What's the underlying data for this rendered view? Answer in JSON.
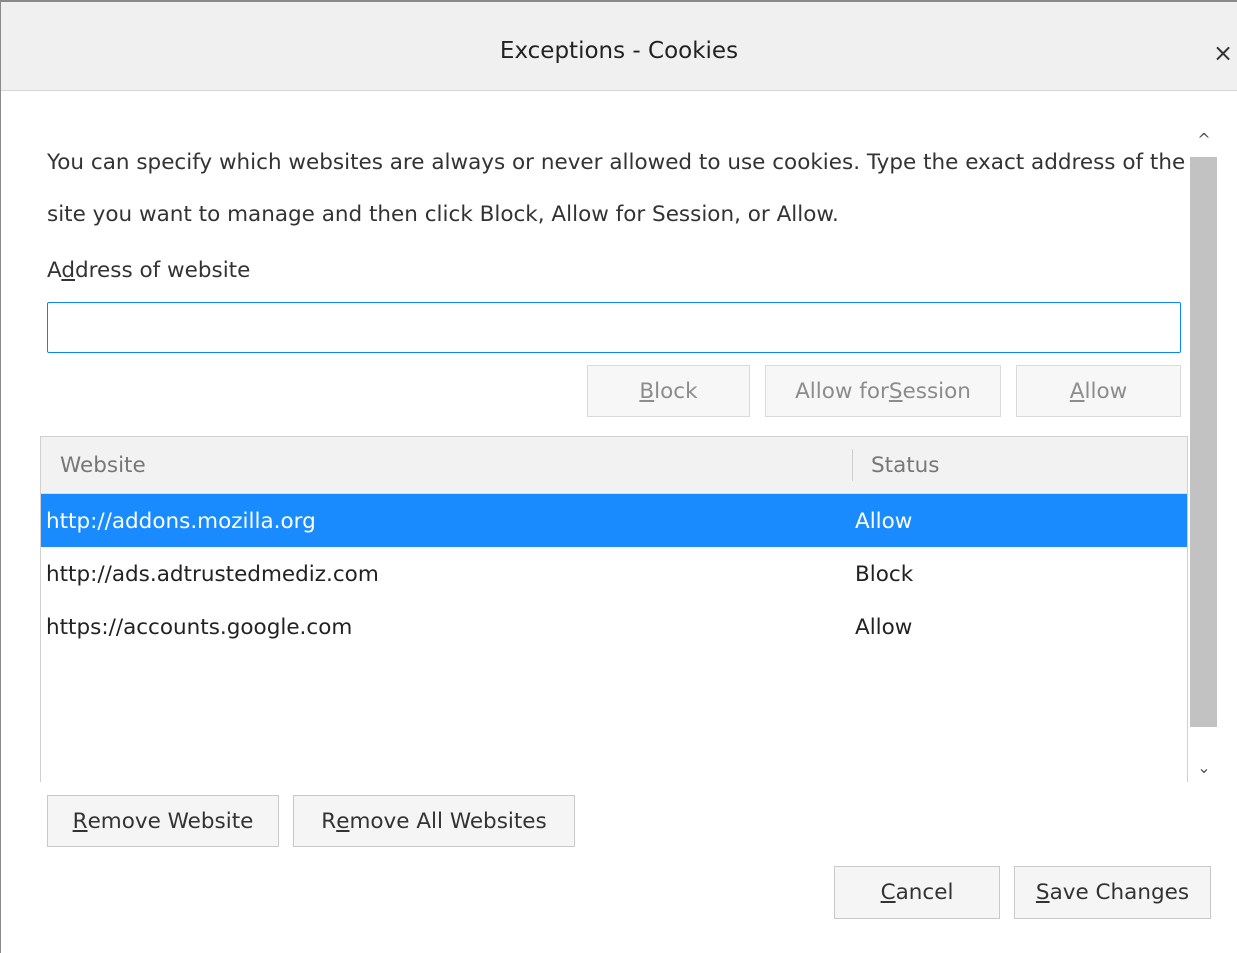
{
  "window": {
    "title": "Exceptions - Cookies",
    "close_glyph": "×"
  },
  "description": "You can specify which websites are always or never allowed to use cookies. Type the exact address of the site you want to manage and then click Block, Allow for Session, or Allow.",
  "address": {
    "label_pre": "A",
    "label_key": "d",
    "label_post": "dress of website",
    "value": "",
    "placeholder": ""
  },
  "action_buttons": {
    "block": {
      "key": "B",
      "rest": "lock"
    },
    "session": {
      "pre": "Allow for ",
      "key": "S",
      "rest": "ession"
    },
    "allow": {
      "key": "A",
      "rest": "llow"
    }
  },
  "table": {
    "columns": [
      "Website",
      "Status"
    ],
    "rows": [
      {
        "website": "http://addons.mozilla.org",
        "status": "Allow",
        "selected": true
      },
      {
        "website": "http://ads.adtrustedmediz.com",
        "status": "Block",
        "selected": false
      },
      {
        "website": "https://accounts.google.com",
        "status": "Allow",
        "selected": false
      }
    ]
  },
  "scrollbar": {
    "up_glyph": "^",
    "down_glyph": "⌄"
  },
  "list_buttons": {
    "remove": {
      "key": "R",
      "rest": "emove Website"
    },
    "remove_all": {
      "pre": "R",
      "key": "e",
      "rest": "move All Websites"
    }
  },
  "footer_buttons": {
    "cancel": {
      "key": "C",
      "rest": "ancel"
    },
    "save": {
      "key": "S",
      "rest": "ave Changes"
    }
  },
  "colors": {
    "accent": "#0a84ff",
    "selection": "#1a8bff",
    "titlebar": "#f0f0f0"
  }
}
